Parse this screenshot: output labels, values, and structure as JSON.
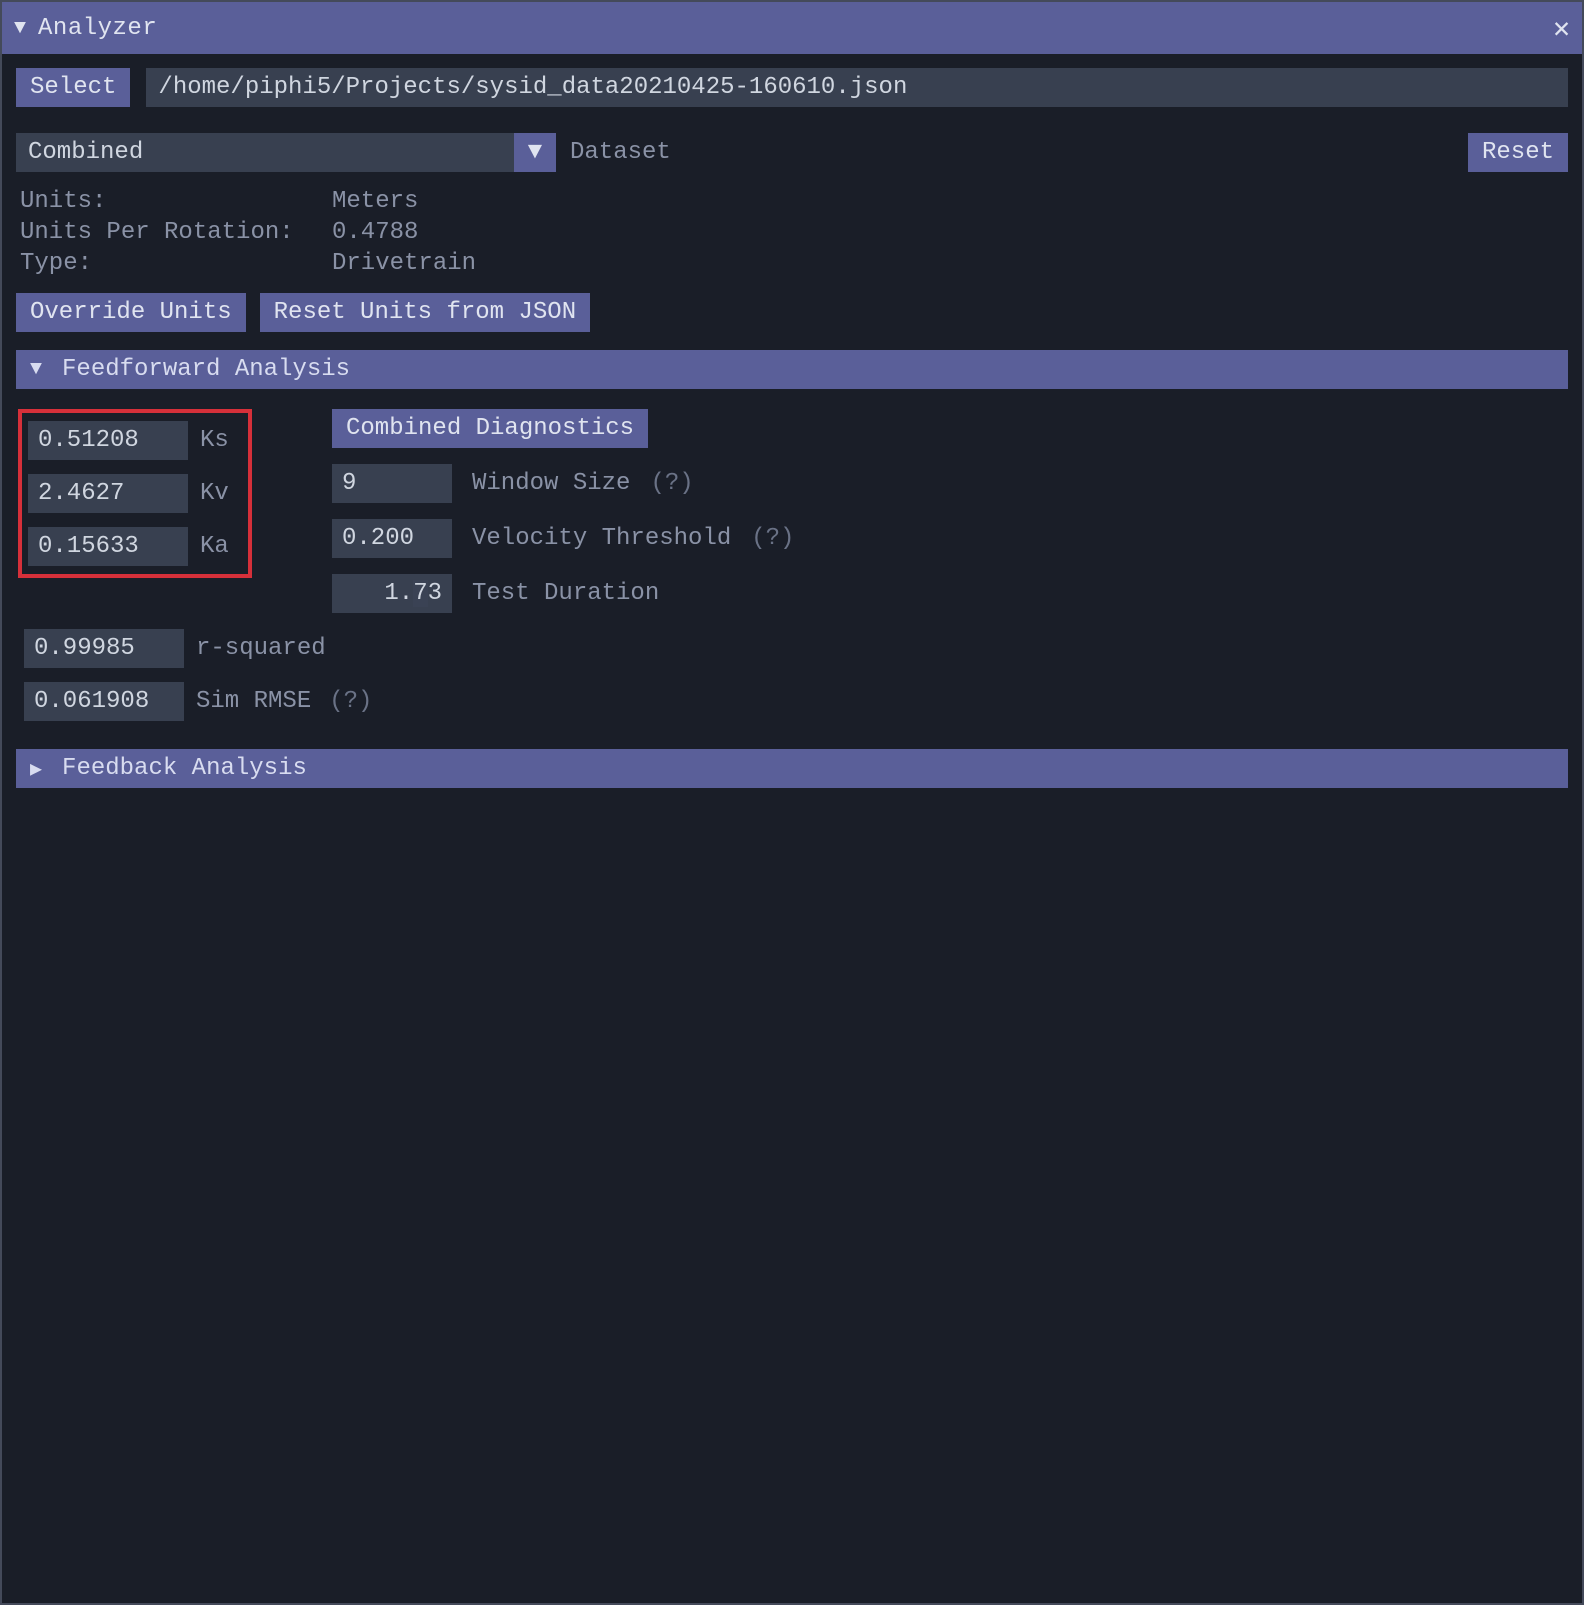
{
  "window": {
    "title": "Analyzer"
  },
  "toolbar": {
    "select_label": "Select",
    "file_path": "/home/piphi5/Projects/sysid_data20210425-160610.json"
  },
  "dataset_row": {
    "combo_value": "Combined",
    "dataset_label": "Dataset",
    "reset_label": "Reset"
  },
  "info": {
    "units_label": "Units:",
    "units_value": "Meters",
    "upr_label": "Units Per Rotation:",
    "upr_value": "0.4788",
    "type_label": "Type:",
    "type_value": "Drivetrain"
  },
  "unit_buttons": {
    "override_label": "Override Units",
    "reset_json_label": "Reset Units from JSON"
  },
  "feedforward": {
    "header": "Feedforward Analysis",
    "gains": {
      "ks_value": "0.51208",
      "ks_label": "Ks",
      "kv_value": "2.4627",
      "kv_label": "Kv",
      "ka_value": "0.15633",
      "ka_label": "Ka"
    },
    "diagnostics": {
      "button_label": "Combined Diagnostics",
      "window_value": "9",
      "window_label": "Window Size",
      "help1": "(?)",
      "velthr_value": "0.200",
      "velthr_label": "Velocity Threshold",
      "help2": "(?)",
      "testdur_prefix": "1.",
      "testdur_sel": "7",
      "testdur_suffix": "3",
      "testdur_label": "Test Duration"
    },
    "r2_value": "0.99985",
    "r2_label": "r-squared",
    "rmse_value": "0.061908",
    "rmse_label": "Sim RMSE",
    "rmse_help": "(?)"
  },
  "feedback": {
    "header": "Feedback Analysis"
  }
}
